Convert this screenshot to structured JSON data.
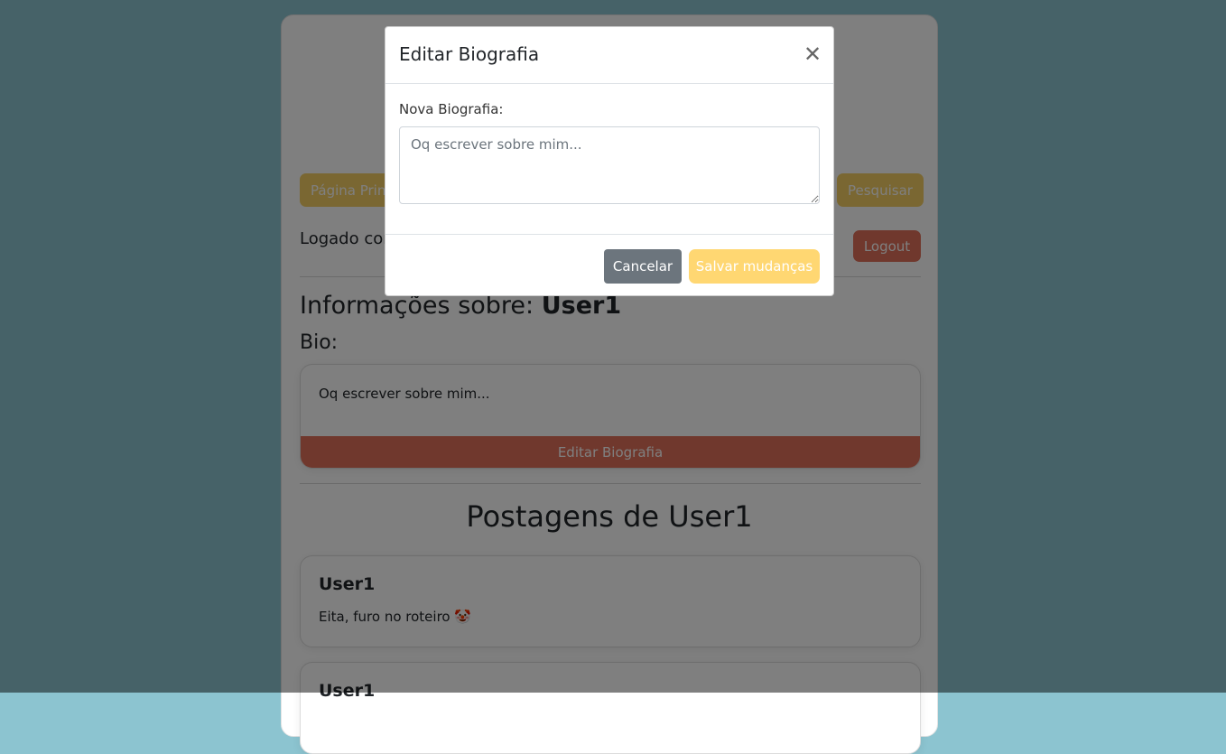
{
  "page": {
    "nav": {
      "home_label": "Página Principal",
      "search_label": "Pesquisar"
    },
    "logged_text": "Logado como",
    "logout_label": "Logout",
    "info_prefix": "Informações sobre:",
    "username": "User1",
    "bio_label": "Bio:",
    "bio_text": "Oq escrever sobre mim...",
    "edit_bio_label": "Editar Biografia",
    "posts_title": "Postagens de User1",
    "posts": [
      {
        "author": "User1",
        "text": "Eita, furo no roteiro 🤡"
      },
      {
        "author": "User1",
        "text": ""
      }
    ]
  },
  "modal": {
    "title": "Editar Biografia",
    "close_icon": "close-icon",
    "field_label": "Nova Biografia:",
    "textarea_placeholder": "Oq escrever sobre mim...",
    "cancel_label": "Cancelar",
    "save_label": "Salvar mudanças"
  },
  "colors": {
    "background": "#8cc4d0",
    "accent_yellow": "#f4cf64",
    "accent_red": "#e0705a",
    "secondary": "#6c757d"
  }
}
